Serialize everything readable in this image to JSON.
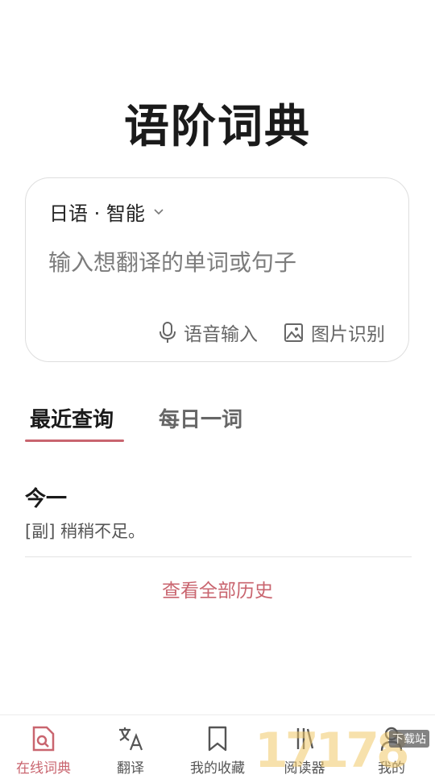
{
  "app": {
    "title": "语阶词典"
  },
  "search": {
    "language_label": "日语 · 智能",
    "placeholder": "输入想翻译的单词或句子",
    "voice_label": "语音输入",
    "image_label": "图片识别"
  },
  "tabs": [
    {
      "label": "最近查询",
      "active": true
    },
    {
      "label": "每日一词",
      "active": false
    }
  ],
  "recent": [
    {
      "word": "今一",
      "definition": "[副] 稍稍不足。"
    }
  ],
  "history_link": "查看全部历史",
  "bottom_nav": [
    {
      "label": "在线词典",
      "icon": "dictionary-search-icon",
      "active": true
    },
    {
      "label": "翻译",
      "icon": "translate-icon",
      "active": false
    },
    {
      "label": "我的收藏",
      "icon": "bookmark-icon",
      "active": false
    },
    {
      "label": "阅读器",
      "icon": "reader-icon",
      "active": false
    },
    {
      "label": "我的",
      "icon": "profile-icon",
      "active": false
    }
  ],
  "watermark": {
    "text": "17178",
    "tag": "下载站"
  },
  "colors": {
    "accent": "#c9656f",
    "text": "#1a1a1a",
    "muted": "#666666",
    "border": "#dedede"
  }
}
